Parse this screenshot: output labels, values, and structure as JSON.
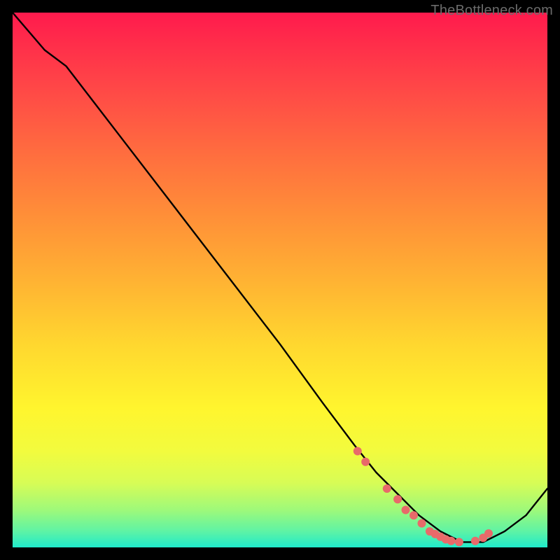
{
  "watermark": "TheBottleneck.com",
  "colors": {
    "background": "#000000",
    "curve_stroke": "#000000",
    "dot_fill": "#e86a6a",
    "dot_stroke": "#c85050"
  },
  "chart_data": {
    "type": "line",
    "title": "",
    "xlabel": "",
    "ylabel": "",
    "xlim": [
      0,
      100
    ],
    "ylim": [
      0,
      100
    ],
    "grid": false,
    "legend": false,
    "series": [
      {
        "name": "curve",
        "x": [
          0,
          6,
          10,
          20,
          30,
          40,
          50,
          58,
          64,
          68,
          72,
          76,
          80,
          84,
          86,
          88,
          92,
          96,
          100
        ],
        "y": [
          100,
          93,
          90,
          77,
          64,
          51,
          38,
          27,
          19,
          14,
          10,
          6,
          3,
          1,
          1,
          1,
          3,
          6,
          11
        ]
      }
    ],
    "dots": {
      "x": [
        64.5,
        66,
        70,
        72,
        73.5,
        75,
        76.5,
        78,
        79,
        80,
        81,
        82,
        83.5,
        86.5,
        88,
        89
      ],
      "y": [
        18,
        16,
        11,
        9,
        7,
        6,
        4.5,
        3,
        2.5,
        2,
        1.5,
        1.2,
        1,
        1.2,
        1.8,
        2.6
      ]
    }
  }
}
